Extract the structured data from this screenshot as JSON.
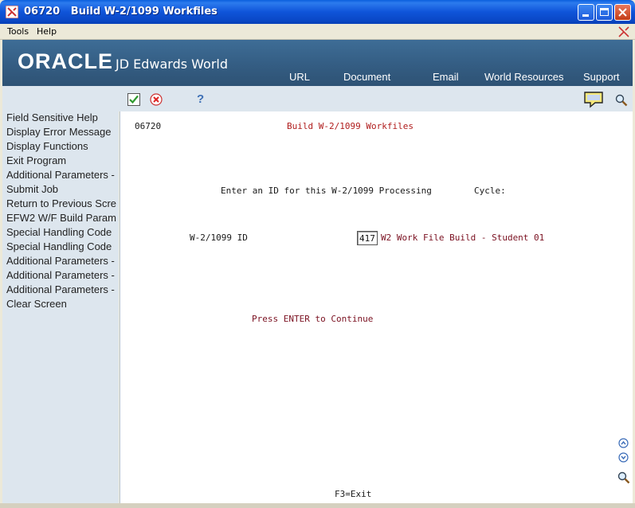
{
  "window": {
    "title": "06720   Build W-2/1099 Workfiles"
  },
  "menu": {
    "tools": "Tools",
    "help": "Help"
  },
  "banner": {
    "brand": "ORACLE",
    "product": "JD Edwards World",
    "links": [
      "URL",
      "Document",
      "Email",
      "World Resources",
      "Support"
    ]
  },
  "functions": [
    "Field Sensitive Help",
    "Display Error Message",
    "Display Functions",
    "Exit Program",
    "Additional Parameters -",
    "Submit Job",
    "Return to Previous Scre",
    "EFW2 W/F Build Param",
    "Special Handling Code",
    "Special Handling Code",
    "Additional Parameters -",
    "Additional Parameters -",
    "Additional Parameters -",
    "Clear Screen"
  ],
  "screen": {
    "program_id": "06720",
    "screen_title": "Build W-2/1099 Workfiles",
    "prompt": "Enter an ID for this W-2/1099 Processing",
    "cycle_label": "Cycle:",
    "id_label": "W-2/1099 ID",
    "id_value": "417",
    "id_description": "W2 Work File Build - Student 01",
    "press_enter": "Press ENTER to Continue",
    "exit_hint": "F3=Exit"
  },
  "colors": {
    "banner": "#345D83",
    "panel": "#DDE6EE",
    "title_red": "#B01C1C"
  }
}
